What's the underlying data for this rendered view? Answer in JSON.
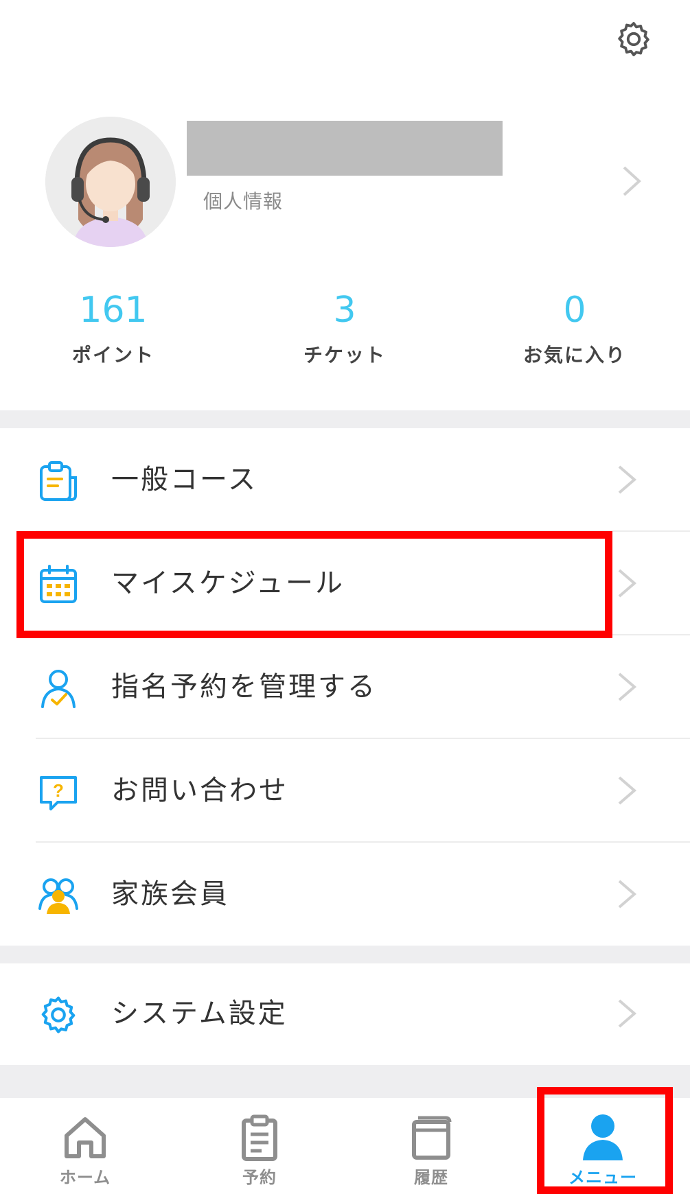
{
  "header": {
    "settings_icon": "gear-icon"
  },
  "profile": {
    "avatar_icon": "headset-woman-avatar",
    "name": "",
    "subtitle": "個人情報"
  },
  "stats": [
    {
      "value": "161",
      "label": "ポイント"
    },
    {
      "value": "3",
      "label": "チケット"
    },
    {
      "value": "0",
      "label": "お気に入り"
    }
  ],
  "menu": {
    "items": [
      {
        "label": "一般コース",
        "icon": "clipboard-icon"
      },
      {
        "label": "マイスケジュール",
        "icon": "calendar-icon"
      },
      {
        "label": "指名予約を管理する",
        "icon": "person-check-icon"
      },
      {
        "label": "お問い合わせ",
        "icon": "question-chat-icon"
      },
      {
        "label": "家族会員",
        "icon": "family-icon"
      }
    ],
    "system": {
      "label": "システム設定",
      "icon": "gear-icon"
    }
  },
  "tabbar": {
    "tabs": [
      {
        "label": "ホーム",
        "icon": "home-icon",
        "active": false
      },
      {
        "label": "予約",
        "icon": "clipboard-icon",
        "active": false
      },
      {
        "label": "履歴",
        "icon": "book-icon",
        "active": false
      },
      {
        "label": "メニュー",
        "icon": "user-icon",
        "active": true
      }
    ]
  },
  "colors": {
    "accent": "#42c8f0",
    "active_tab": "#1aa3f0",
    "icon_yellow": "#f7b500",
    "highlight": "#ff0000",
    "separator": "#eeeef0"
  }
}
